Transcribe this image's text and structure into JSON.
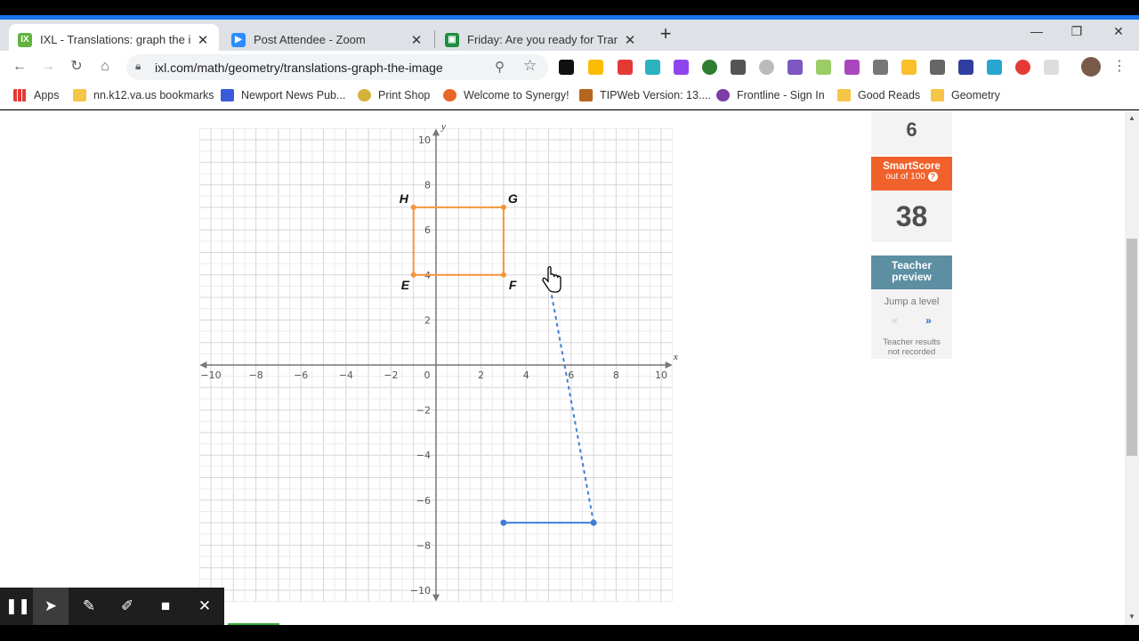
{
  "browser": {
    "tabs": [
      {
        "title": "IXL - Translations: graph the imag",
        "favicon": "ixl-icon",
        "active": true
      },
      {
        "title": "Post Attendee - Zoom",
        "favicon": "zoom-icon",
        "active": false
      },
      {
        "title": "Friday: Are you ready for Transfo",
        "favicon": "classroom-icon",
        "active": false
      }
    ],
    "new_tab": "+",
    "url": "ixl.com/math/geometry/translations-graph-the-image",
    "bookmarks": [
      {
        "label": "Apps",
        "icon": "apps-grid-icon"
      },
      {
        "label": "nn.k12.va.us bookmarks",
        "icon": "folder-icon"
      },
      {
        "label": "Newport News Pub...",
        "icon": "calendar-icon"
      },
      {
        "label": "Print Shop",
        "icon": "printshop-icon"
      },
      {
        "label": "Welcome to Synergy!",
        "icon": "synergy-icon"
      },
      {
        "label": "TIPWeb Version: 13....",
        "icon": "tipweb-icon"
      },
      {
        "label": "Frontline - Sign In",
        "icon": "frontline-icon"
      },
      {
        "label": "Good Reads",
        "icon": "folder-icon"
      },
      {
        "label": "Geometry",
        "icon": "folder-icon"
      }
    ]
  },
  "graph": {
    "x_axis_label": "x",
    "y_axis_label": "y",
    "x_ticks": [
      "−10",
      "−8",
      "−6",
      "−4",
      "−2",
      "0",
      "2",
      "4",
      "6",
      "8",
      "10"
    ],
    "y_ticks": [
      "10",
      "8",
      "6",
      "4",
      "2",
      "−2",
      "−4",
      "−6",
      "−8",
      "−10"
    ],
    "range": [
      -10.5,
      10.5
    ],
    "original_shape": {
      "color": "#f5953a",
      "vertices": [
        {
          "label": "E",
          "x": -1,
          "y": 4
        },
        {
          "label": "F",
          "x": 3,
          "y": 4
        },
        {
          "label": "G",
          "x": 3,
          "y": 7
        },
        {
          "label": "H",
          "x": -1,
          "y": 7
        }
      ]
    },
    "drawn_segment": {
      "color": "#3d7fd6",
      "from": {
        "x": 3,
        "y": -7
      },
      "to": {
        "x": 7,
        "y": -7
      }
    },
    "dashed_line": {
      "color": "#3d7fd6",
      "from": {
        "x": 7,
        "y": -7
      },
      "to": {
        "x": 5.1,
        "y": 3.3
      }
    }
  },
  "sidebar": {
    "questions_answered": "6",
    "smartscore_title": "SmartScore",
    "smartscore_sub": "out of 100",
    "smartscore_help": "?",
    "smartscore": "38",
    "teacher_preview_line1": "Teacher",
    "teacher_preview_line2": "preview",
    "jump_level": "Jump a level",
    "prev_level": "«",
    "next_level": "»",
    "teacher_note_line1": "Teacher results",
    "teacher_note_line2": "not recorded"
  },
  "recorder": {
    "tools": [
      "pause-icon",
      "pointer-icon",
      "pen-icon",
      "highlighter-icon",
      "camera-icon",
      "close-icon"
    ]
  },
  "colors": {
    "accent": "#1a73e8",
    "smartscore": "#f0612b",
    "teacher_preview": "#5d8fa3"
  }
}
